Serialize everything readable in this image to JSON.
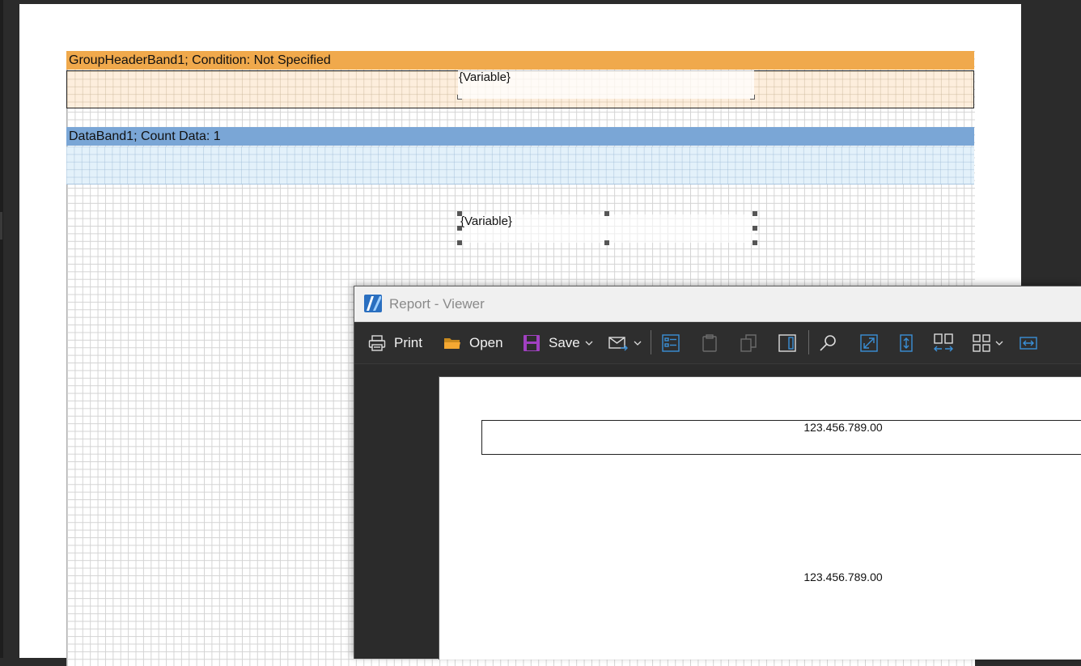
{
  "designer": {
    "group_header_caption": "GroupHeaderBand1; Condition: Not Specified",
    "group_header_textbox": "{Variable}",
    "data_band_caption": "DataBand1; Count Data: 1",
    "data_textbox": "{Variable}"
  },
  "viewer": {
    "title": "Report - Viewer",
    "toolbar": {
      "print_label": "Print",
      "open_label": "Open",
      "save_label": "Save"
    },
    "preview": {
      "value_1": "123.456.789.00",
      "value_2": "123.456.789.00"
    }
  },
  "colors": {
    "group_header": "#f0a94c",
    "data_band": "#7aa6d6",
    "save_icon": "#a040c0",
    "open_icon": "#f0a030",
    "accent_blue": "#3a8fd6"
  },
  "icons": [
    "app-logo-icon",
    "print-icon",
    "open-folder-icon",
    "save-disk-icon",
    "email-send-icon",
    "bookmarks-icon",
    "clipboard-icon",
    "copy-icon",
    "page-layout-icon",
    "find-icon",
    "full-screen-icon",
    "page-height-icon",
    "multiple-pages-icon",
    "view-mode-icon",
    "page-width-icon"
  ]
}
